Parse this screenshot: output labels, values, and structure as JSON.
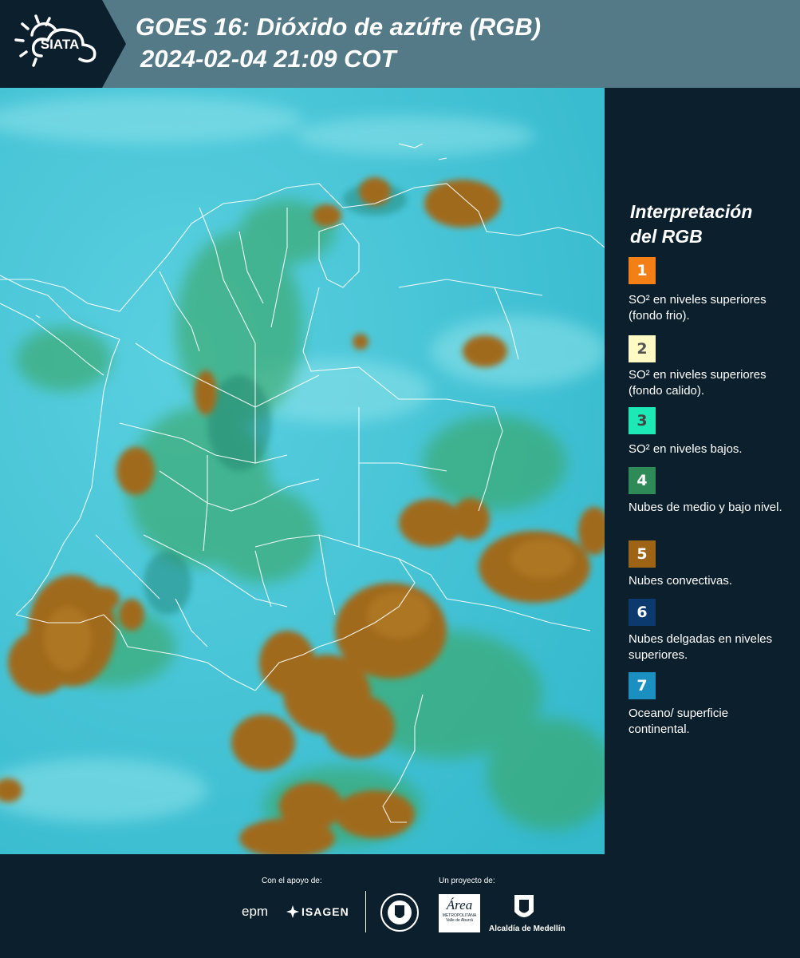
{
  "header": {
    "title_line1": "GOES 16: Dióxido de azúfre (RGB)",
    "title_line2": "2024-02-04 21:09 COT",
    "brand_logo_text": "SIATA"
  },
  "legend": {
    "title_line1": "Interpretación",
    "title_line2": "del RGB",
    "items": [
      {
        "number": "1",
        "color": "#f57f17",
        "text_color": "#ffffff",
        "description": "SO² en niveles superiores (fondo frio)."
      },
      {
        "number": "2",
        "color": "#fff9c4",
        "text_color": "#555555",
        "description": "SO² en niveles superiores (fondo calido)."
      },
      {
        "number": "3",
        "color": "#1de9b6",
        "text_color": "#444444",
        "description": "SO² en niveles bajos."
      },
      {
        "number": "4",
        "color": "#2e8b57",
        "text_color": "#ffffff",
        "description": "Nubes de medio y bajo nivel."
      },
      {
        "number": "5",
        "color": "#9c6414",
        "text_color": "#ffffff",
        "description": "Nubes convectivas."
      },
      {
        "number": "6",
        "color": "#0d3a6e",
        "text_color": "#ffffff",
        "description": "Nubes delgadas en niveles superiores."
      },
      {
        "number": "7",
        "color": "#1a8fc0",
        "text_color": "#ffffff",
        "description": "Oceano/ superficie continental."
      }
    ]
  },
  "footer": {
    "support_label": "Con el apoyo de:",
    "project_label": "Un proyecto de:",
    "sponsors": [
      "epm",
      "ISAGEN"
    ],
    "partners": [
      "Área Metropolitana Valle de Aburrá",
      "Alcaldía de Medellín"
    ],
    "partner_text": {
      "area_logo": "Área",
      "area_sub1": "METROPOLITANA",
      "area_sub2": "Valle de Aburrá",
      "alcaldia": "Alcaldía de Medellín"
    }
  },
  "colors": {
    "header_bg": "#557a87",
    "background": "#0c1f2c",
    "ocean": "#3fc3d6",
    "convective": "#9c6414",
    "border_lines": "#ffffff"
  }
}
